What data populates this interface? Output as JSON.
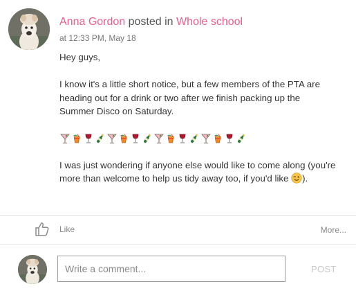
{
  "post": {
    "author": "Anna Gordon",
    "action": " posted in ",
    "group": "Whole school",
    "timestamp": "at 12:33 PM, May 18",
    "greeting": "Hey guys,",
    "paragraph1": "I know it's a little short notice, but a few members of the PTA are heading out for a drink or two after we finish packing up the Summer Disco on Saturday.",
    "emoji_sequence": [
      "cocktail-emoji",
      "tropical-drink-emoji",
      "wine-glass-emoji",
      "champagne-emoji",
      "cocktail-emoji",
      "tropical-drink-emoji",
      "wine-glass-emoji",
      "champagne-emoji",
      "cocktail-emoji",
      "tropical-drink-emoji",
      "wine-glass-emoji",
      "champagne-emoji",
      "cocktail-emoji",
      "tropical-drink-emoji",
      "wine-glass-emoji",
      "champagne-emoji"
    ],
    "paragraph2": "I was just wondering if anyone else would like to come along (you're more than welcome to help us tidy away too, if you'd like ",
    "paragraph2_end": ").",
    "end_emoji": "winking-face-emoji"
  },
  "actions": {
    "like_label": "Like",
    "more_label": "More..."
  },
  "comment": {
    "placeholder": "Write a comment...",
    "post_label": "POST"
  },
  "colors": {
    "accent": "#e85f8e",
    "post_disabled": "#c8c8c8"
  }
}
